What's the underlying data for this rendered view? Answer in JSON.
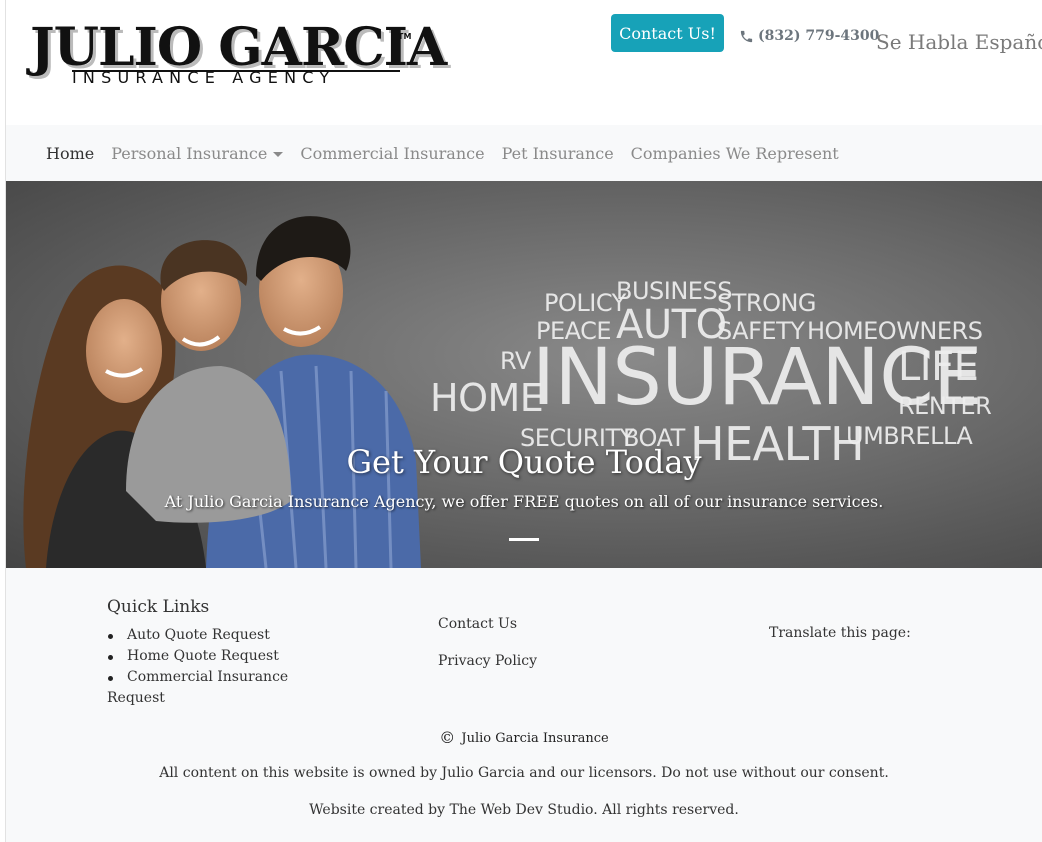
{
  "header": {
    "logo_name": "JULIO GARCIA",
    "logo_tm": "TM",
    "logo_sub": "INSURANCE AGENCY",
    "contact_button": "Contact Us!",
    "phone": "(832) 779-4300",
    "habla": "Se Habla Español",
    "accent_color": "#17a2b8"
  },
  "nav": {
    "items": [
      {
        "label": "Home",
        "active": true
      },
      {
        "label": "Personal Insurance",
        "dropdown": true
      },
      {
        "label": "Commercial Insurance"
      },
      {
        "label": "Pet Insurance"
      },
      {
        "label": "Companies We Represent"
      }
    ]
  },
  "hero": {
    "words": {
      "policy": "POLICY",
      "business": "BUSINESS",
      "strong": "STRONG",
      "peace": "PEACE",
      "auto": "AUTO",
      "safety": "SAFETY",
      "homeowners": "HOMEOWNERS",
      "rv": "RV",
      "home": "HOME",
      "insurance": "INSURANCE",
      "life": "LIFE",
      "renter": "RENTER",
      "security": "SECURITY",
      "boat": "BOAT",
      "health": "HEALTH",
      "umbrella": "UMBRELLA"
    },
    "title": "Get Your Quote Today",
    "subtitle": "At Julio Garcia Insurance Agency, we offer FREE quotes on all of our insurance services."
  },
  "footer": {
    "quick_links_title": "Quick Links",
    "quick_links": [
      "Auto Quote Request",
      "Home Quote Request",
      "Commercial Insurance"
    ],
    "quick_links_wrap": "Request",
    "contact_us": "Contact Us",
    "privacy": "Privacy Policy",
    "translate": "Translate this page:",
    "copyright": "Julio Garcia Insurance",
    "owned": "All content on this website is owned by Julio Garcia and our licensors. Do not use without our consent.",
    "created": "Website created by The Web Dev Studio. All rights reserved."
  }
}
